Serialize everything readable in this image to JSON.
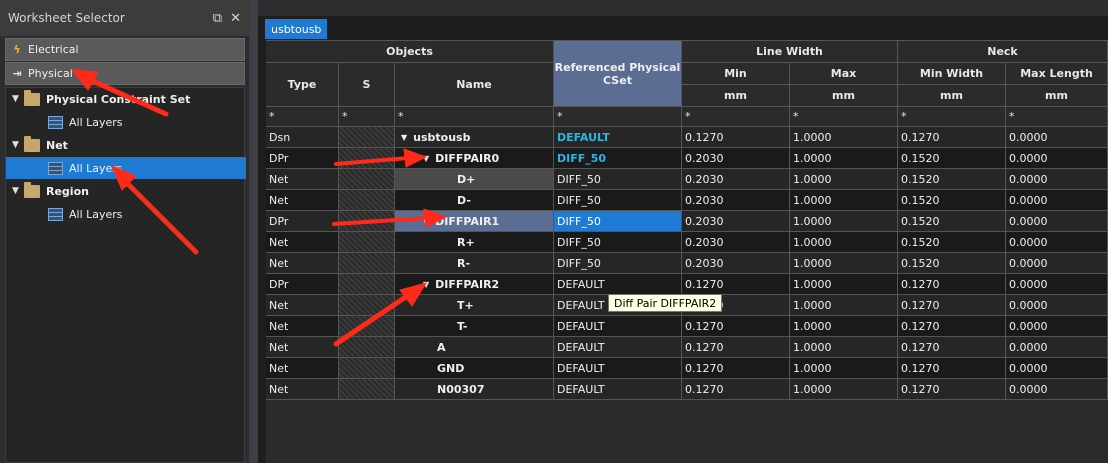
{
  "left_panel": {
    "title": "Worksheet Selector",
    "electrical_label": "Electrical",
    "physical_label": "Physical",
    "tree": [
      {
        "label": "Physical Constraint Set",
        "type": "folder"
      },
      {
        "label": "All Layers",
        "type": "layer"
      },
      {
        "label": "Net",
        "type": "folder"
      },
      {
        "label": "All Layers",
        "type": "layer",
        "selected": true
      },
      {
        "label": "Region",
        "type": "folder"
      },
      {
        "label": "All Layers",
        "type": "layer"
      }
    ]
  },
  "tab_label": "usbtousb",
  "headers": {
    "objects": "Objects",
    "type": "Type",
    "s": "S",
    "name": "Name",
    "ref_cset": "Referenced Physical CSet",
    "line_width": "Line Width",
    "neck": "Neck",
    "min": "Min",
    "max": "Max",
    "min_width": "Min Width",
    "max_length": "Max Length",
    "unit": "mm"
  },
  "filter_value": "*",
  "rows": [
    {
      "type": "Dsn",
      "name": "usbtousb",
      "cset": "DEFAULT",
      "lw_min": "0.1270",
      "lw_max": "1.0000",
      "neck_min": "0.1270",
      "neck_max": "0.0000"
    },
    {
      "type": "DPr",
      "name": "DIFFPAIR0",
      "cset": "DIFF_50",
      "lw_min": "0.2030",
      "lw_max": "1.0000",
      "neck_min": "0.1520",
      "neck_max": "0.0000"
    },
    {
      "type": "Net",
      "name": "D+",
      "cset": "DIFF_50",
      "lw_min": "0.2030",
      "lw_max": "1.0000",
      "neck_min": "0.1520",
      "neck_max": "0.0000"
    },
    {
      "type": "Net",
      "name": "D-",
      "cset": "DIFF_50",
      "lw_min": "0.2030",
      "lw_max": "1.0000",
      "neck_min": "0.1520",
      "neck_max": "0.0000"
    },
    {
      "type": "DPr",
      "name": "DIFFPAIR1",
      "cset": "DIFF_50",
      "lw_min": "0.2030",
      "lw_max": "1.0000",
      "neck_min": "0.1520",
      "neck_max": "0.0000"
    },
    {
      "type": "Net",
      "name": "R+",
      "cset": "DIFF_50",
      "lw_min": "0.2030",
      "lw_max": "1.0000",
      "neck_min": "0.1520",
      "neck_max": "0.0000"
    },
    {
      "type": "Net",
      "name": "R-",
      "cset": "DIFF_50",
      "lw_min": "0.2030",
      "lw_max": "1.0000",
      "neck_min": "0.1520",
      "neck_max": "0.0000"
    },
    {
      "type": "DPr",
      "name": "DIFFPAIR2",
      "cset": "DEFAULT",
      "lw_min": "0.1270",
      "lw_max": "1.0000",
      "neck_min": "0.1270",
      "neck_max": "0.0000"
    },
    {
      "type": "Net",
      "name": "T+",
      "cset": "DEFAULT",
      "lw_min": "0.1270",
      "lw_max": "1.0000",
      "neck_min": "0.1270",
      "neck_max": "0.0000"
    },
    {
      "type": "Net",
      "name": "T-",
      "cset": "DEFAULT",
      "lw_min": "0.1270",
      "lw_max": "1.0000",
      "neck_min": "0.1270",
      "neck_max": "0.0000"
    },
    {
      "type": "Net",
      "name": "A",
      "cset": "DEFAULT",
      "lw_min": "0.1270",
      "lw_max": "1.0000",
      "neck_min": "0.1270",
      "neck_max": "0.0000"
    },
    {
      "type": "Net",
      "name": "GND",
      "cset": "DEFAULT",
      "lw_min": "0.1270",
      "lw_max": "1.0000",
      "neck_min": "0.1270",
      "neck_max": "0.0000"
    },
    {
      "type": "Net",
      "name": "N00307",
      "cset": "DEFAULT",
      "lw_min": "0.1270",
      "lw_max": "1.0000",
      "neck_min": "0.1270",
      "neck_max": "0.0000"
    }
  ],
  "tooltip": "Diff Pair DIFFPAIR2",
  "colors": {
    "accent": "#1e7ad2",
    "header_ref": "#5c6d94",
    "cyan": "#29b6e6",
    "arrow": "#ff2a1a"
  }
}
